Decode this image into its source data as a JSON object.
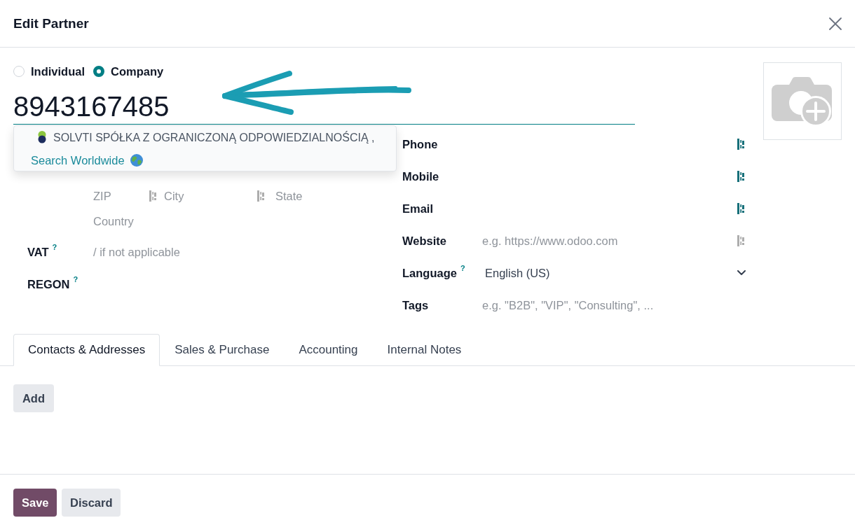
{
  "dialog": {
    "title": "Edit Partner"
  },
  "company_type": [
    {
      "label": "Individual",
      "selected": false
    },
    {
      "label": "Company",
      "selected": true
    }
  ],
  "name_field": {
    "value": "8943167485",
    "focused": true
  },
  "autocomplete": [
    {
      "kind": "company",
      "label": "SOLVTI SPÓŁKA Z OGRANICZONĄ ODPOWIEDZIALNOŚCIĄ ,"
    },
    {
      "kind": "search",
      "label": "Search Worldwide"
    }
  ],
  "address": [
    {
      "placeholder": "ZIP"
    },
    {
      "placeholder": "City",
      "icon_active": false
    },
    {
      "placeholder": "State",
      "icon_active": false
    }
  ],
  "country": {
    "placeholder": "Country"
  },
  "left_fields": [
    {
      "label": "VAT",
      "help": "?",
      "placeholder": "/ if not applicable"
    },
    {
      "label": "REGON",
      "help": "?"
    }
  ],
  "right_fields": [
    {
      "kind": "text",
      "label": "Phone",
      "icon_active": true
    },
    {
      "kind": "text",
      "label": "Mobile",
      "icon_active": true
    },
    {
      "kind": "text",
      "label": "Email",
      "icon_active": true
    },
    {
      "kind": "text",
      "label": "Website",
      "placeholder": "e.g. https://www.odoo.com",
      "icon_active": false
    },
    {
      "kind": "select",
      "label": "Language",
      "help": "?",
      "value": "English (US)"
    },
    {
      "kind": "tags",
      "label": "Tags",
      "placeholder": "e.g. \"B2B\", \"VIP\", \"Consulting\", ..."
    }
  ],
  "tabs": [
    {
      "label": "Contacts & Addresses",
      "selected": true
    },
    {
      "label": "Sales & Purchase",
      "selected": false
    },
    {
      "label": "Accounting",
      "selected": false
    },
    {
      "label": "Internal Notes",
      "selected": false
    }
  ],
  "add_button": {
    "label": "Add"
  },
  "footer_buttons": [
    {
      "kind": "primary",
      "label": "Save"
    },
    {
      "kind": "secondary",
      "label": "Discard"
    }
  ]
}
